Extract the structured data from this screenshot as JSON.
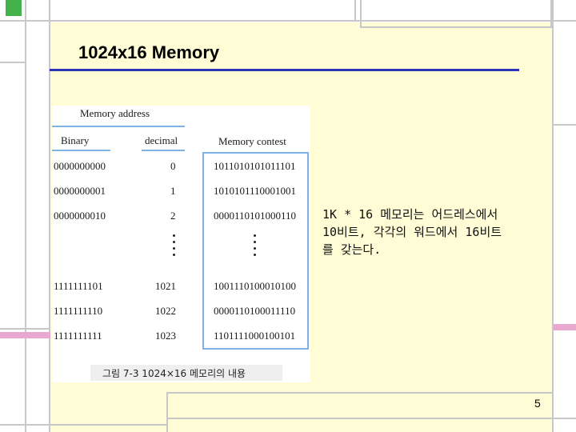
{
  "slide": {
    "title": "1024x16 Memory",
    "page_number": "5",
    "description_lines": [
      "1K * 16 메모리는 어드레스에서",
      "10비트, 각각의 워드에서 16비트",
      "를 갖는다."
    ]
  },
  "figure": {
    "header_memory_address": "Memory address",
    "header_binary": "Binary",
    "header_decimal": "decimal",
    "header_contents": "Memory contest",
    "rows_top": [
      {
        "binary": "0000000000",
        "decimal": "0",
        "contents": "1011010101011101"
      },
      {
        "binary": "0000000001",
        "decimal": "1",
        "contents": "1010101110001001"
      },
      {
        "binary": "0000000010",
        "decimal": "2",
        "contents": "0000110101000110"
      }
    ],
    "rows_bottom": [
      {
        "binary": "1111111101",
        "decimal": "1021",
        "contents": "1001110100010100"
      },
      {
        "binary": "1111111110",
        "decimal": "1022",
        "contents": "0000110100011110"
      },
      {
        "binary": "1111111111",
        "decimal": "1023",
        "contents": "1101111000100101"
      }
    ],
    "caption": "그림 7-3  1024×16 메모리의 내용"
  }
}
